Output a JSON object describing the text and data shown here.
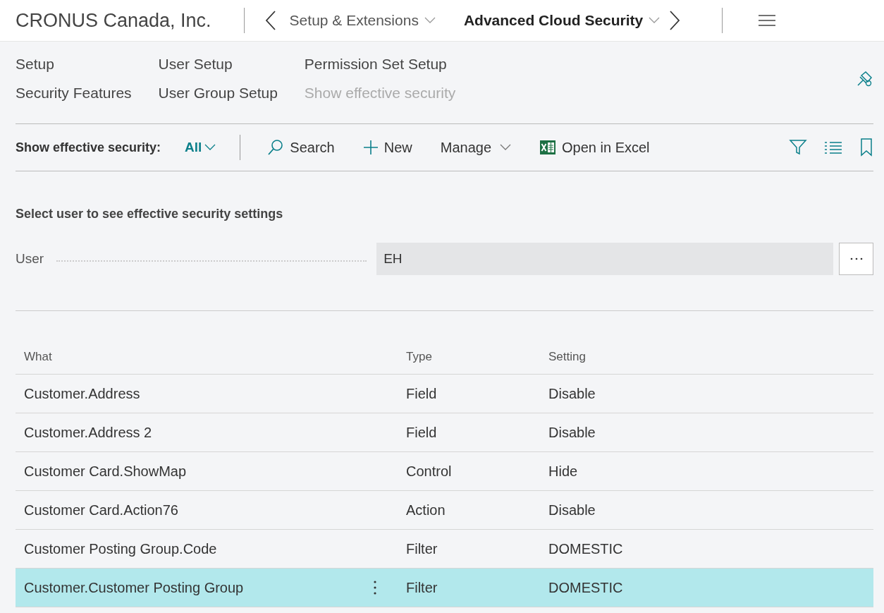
{
  "header": {
    "company": "CRONUS Canada, Inc.",
    "breadcrumbs": [
      {
        "label": "Setup & Extensions",
        "current": false
      },
      {
        "label": "Advanced Cloud Security",
        "current": true
      }
    ]
  },
  "actions": [
    {
      "label": "Setup",
      "disabled": false
    },
    {
      "label": "Security Features",
      "disabled": false
    },
    {
      "label": "User Setup",
      "disabled": false
    },
    {
      "label": "User Group Setup",
      "disabled": false
    },
    {
      "label": "Permission Set Setup",
      "disabled": false
    },
    {
      "label": "Show effective security",
      "disabled": true
    }
  ],
  "toolbar": {
    "filter_label": "Show effective security:",
    "filter_value": "All",
    "buttons": [
      {
        "label": "Search",
        "kind": "search"
      },
      {
        "label": "New",
        "kind": "new"
      },
      {
        "label": "Manage",
        "kind": "manage"
      },
      {
        "label": "Open in Excel",
        "kind": "excel"
      }
    ]
  },
  "form": {
    "heading": "Select user to see effective security settings",
    "field_label": "User",
    "field_value": "EH"
  },
  "table": {
    "columns": [
      "What",
      "Type",
      "Setting"
    ],
    "rows": [
      {
        "what": "Customer.Address",
        "type": "Field",
        "setting": "Disable",
        "selected": false
      },
      {
        "what": "Customer.Address 2",
        "type": "Field",
        "setting": "Disable",
        "selected": false
      },
      {
        "what": "Customer Card.ShowMap",
        "type": "Control",
        "setting": "Hide",
        "selected": false
      },
      {
        "what": "Customer Card.Action76",
        "type": "Action",
        "setting": "Disable",
        "selected": false
      },
      {
        "what": "Customer Posting Group.Code",
        "type": "Filter",
        "setting": "DOMESTIC",
        "selected": false
      },
      {
        "what": "Customer.Customer Posting Group",
        "type": "Filter",
        "setting": "DOMESTIC",
        "selected": true
      }
    ]
  }
}
